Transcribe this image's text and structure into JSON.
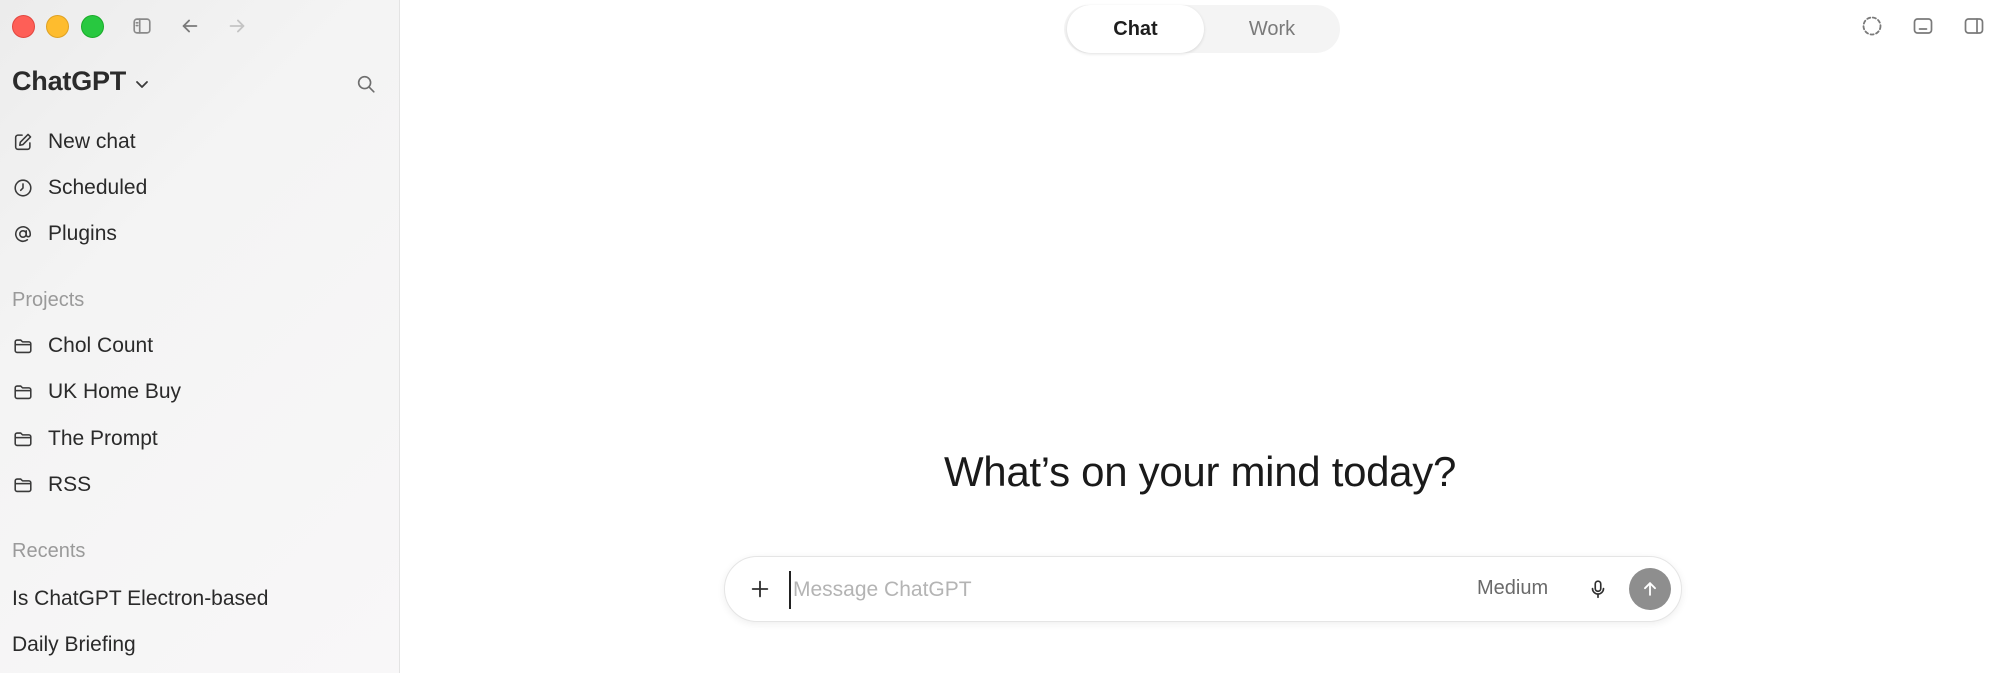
{
  "window": {
    "traffic_lights": [
      "close",
      "minimize",
      "zoom"
    ]
  },
  "sidebar": {
    "brand": "ChatGPT",
    "nav": [
      {
        "label": "New chat",
        "icon": "pencil-square-icon"
      },
      {
        "label": "Scheduled",
        "icon": "clock-icon"
      },
      {
        "label": "Plugins",
        "icon": "at-sign-icon"
      }
    ],
    "projects_heading": "Projects",
    "projects": [
      {
        "label": "Chol Count",
        "icon": "folder-icon"
      },
      {
        "label": "UK Home Buy",
        "icon": "folder-icon"
      },
      {
        "label": "The Prompt",
        "icon": "folder-icon"
      },
      {
        "label": "RSS",
        "icon": "folder-icon"
      }
    ],
    "recents_heading": "Recents",
    "recents": [
      {
        "label": "Is ChatGPT Electron-based"
      },
      {
        "label": "Daily Briefing"
      }
    ]
  },
  "mode_switch": {
    "options": [
      "Chat",
      "Work"
    ],
    "selected": "Chat"
  },
  "main": {
    "headline": "What’s on your mind today?"
  },
  "composer": {
    "placeholder": "Message ChatGPT",
    "value": "",
    "model": "Medium"
  },
  "colors": {
    "send_button": "#8e8e8e",
    "sidebar_bg": "#f3f3f3",
    "close": "#fe5f57",
    "minimize": "#febc2e",
    "zoom": "#28c840"
  }
}
